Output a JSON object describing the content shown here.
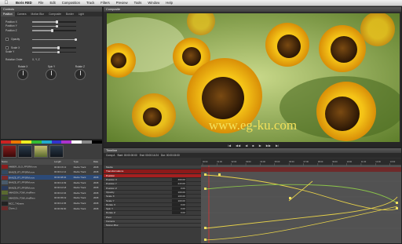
{
  "menubar": {
    "items": [
      "Boris RED",
      "File",
      "Edit",
      "Composition",
      "Track",
      "Filters",
      "Preview",
      "Tools",
      "Window",
      "Help"
    ]
  },
  "controls": {
    "title": "Controls",
    "tabs": [
      "Position",
      "Camera",
      "Motion Blur",
      "Composite",
      "Border",
      "Light"
    ],
    "rows": [
      {
        "label": "Position X",
        "fill": 0.55
      },
      {
        "label": "Position Y",
        "fill": 0.55
      },
      {
        "label": "Position Z",
        "fill": 0.45
      },
      {
        "label": "Opacity",
        "fill": 1.0
      },
      {
        "label": "Scale X",
        "fill": 0.6
      },
      {
        "label": "Scale Y",
        "fill": 0.6
      }
    ],
    "rotation_order_label": "Rotation Order",
    "rotation_order_value": "X, Y, Z",
    "dials": [
      "Rotate X",
      "Spin Y",
      "Rotate Z"
    ]
  },
  "composer": {
    "title": "Composite",
    "watermark": "www.eg-ku.com",
    "transport": [
      "|◀",
      "◀◀",
      "◀",
      "■",
      "▶",
      "▶▶",
      "▶|"
    ]
  },
  "browser": {
    "columns": [
      "Name",
      "Length",
      "Type",
      "Date"
    ],
    "rows": [
      {
        "name": "AMBER_GLO_FPSRM.mov",
        "length": "00:00:15:13",
        "type": "Media Track",
        "date": "2008"
      },
      {
        "name": "BANZE_RT_FPSRM.mov",
        "length": "00:00:11:14",
        "type": "Media Track",
        "date": "2008"
      },
      {
        "name": "BANZE_RT_FPSRM.mov",
        "length": "00:00:08:04",
        "type": "Media Track",
        "date": "2008"
      },
      {
        "name": "BANZE_RT_FPSRM.mov",
        "length": "00:00:13:09",
        "type": "Media Track",
        "date": "2008"
      },
      {
        "name": "BANZE_RT_FPSRM.mov",
        "length": "00:00:10:18",
        "type": "Media Track",
        "date": "2008"
      },
      {
        "name": "AMAZON_TOW_AndRem",
        "length": "00:00:10:04",
        "type": "Media Track",
        "date": "2008"
      },
      {
        "name": "AMAZON_TOW_AndRem",
        "length": "00:00:05:19",
        "type": "Media Track",
        "date": "2008"
      },
      {
        "name": "MCC_T-Kisses",
        "length": "00:00:12:05",
        "type": "Media Track",
        "date": "2008"
      },
      {
        "name": "Clone_1",
        "length": "00:00:09:00",
        "type": "Media Track",
        "date": "2008"
      }
    ]
  },
  "timeline": {
    "title": "Timeline",
    "comp_label": "Comp A",
    "tools": [
      "Start: 00:00:00:00",
      "End: 00:00:14:24",
      "Dur: 00:00:15:00"
    ],
    "layers": [
      {
        "name": "Media",
        "value": "",
        "style": "dark"
      },
      {
        "name": "Transformations",
        "value": "",
        "style": "hl"
      },
      {
        "name": "Position",
        "value": "",
        "style": "sub"
      },
      {
        "name": "Position X",
        "value": "360.00",
        "style": ""
      },
      {
        "name": "Position Y",
        "value": "243.00",
        "style": ""
      },
      {
        "name": "Position Z",
        "value": "0.00",
        "style": ""
      },
      {
        "name": "Opacity",
        "value": "100.00",
        "style": ""
      },
      {
        "name": "Scale X",
        "value": "100.00",
        "style": ""
      },
      {
        "name": "Scale Y",
        "value": "100.00",
        "style": ""
      },
      {
        "name": "Rotate X",
        "value": "0.00",
        "style": ""
      },
      {
        "name": "Spin Y",
        "value": "0.00",
        "style": ""
      },
      {
        "name": "Rotate Z",
        "value": "0.00",
        "style": ""
      },
      {
        "name": "Pivot",
        "value": "",
        "style": "dark"
      },
      {
        "name": "Camera",
        "value": "",
        "style": "dark"
      },
      {
        "name": "Motion Blur",
        "value": "",
        "style": "dark"
      }
    ],
    "ruler_ticks": [
      "00:00",
      "01:00",
      "02:00",
      "03:00",
      "04:00",
      "05:00",
      "06:00",
      "07:00",
      "08:00",
      "09:00",
      "10:00",
      "11:00",
      "12:00",
      "13:00"
    ]
  },
  "colors": {
    "accent_red": "#a51f1f",
    "selection_blue": "#2c4a78",
    "curve_yellow": "#e8d24a",
    "curve_green": "#8bc34a"
  }
}
